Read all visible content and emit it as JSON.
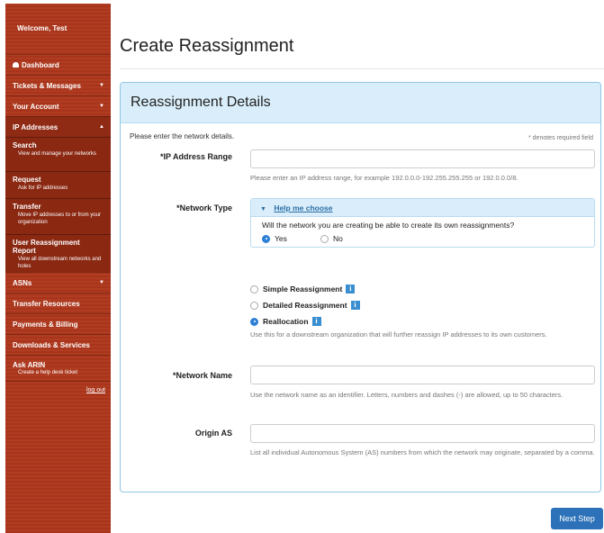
{
  "sidebar": {
    "welcome": "Welcome, Test",
    "dashboard": "Dashboard",
    "tickets": "Tickets & Messages",
    "account": "Your Account",
    "ip_addresses": "IP Addresses",
    "search": {
      "label": "Search",
      "desc": "View and manage your networks"
    },
    "request": {
      "label": "Request",
      "desc": "Ask for IP addresses"
    },
    "transfer": {
      "label": "Transfer",
      "desc": "Move IP addresses to or from your organization"
    },
    "user_report": {
      "label": "User Reassignment Report",
      "desc": "View all downstream networks and holes"
    },
    "asns": "ASNs",
    "transfer_resources": "Transfer Resources",
    "payments": "Payments & Billing",
    "downloads": "Downloads & Services",
    "ask": {
      "label": "Ask ARIN",
      "desc": "Create a help desk ticket"
    },
    "logout": "log out"
  },
  "page": {
    "title": "Create Reassignment"
  },
  "panel": {
    "title": "Reassignment Details",
    "intro": "Please enter the network details.",
    "required_note": "* denotes required field"
  },
  "form": {
    "ip_range": {
      "label": "*IP Address Range",
      "value": "",
      "help": "Please enter an IP address range, for example 192.0.0.0-192.255.255.255 or 192.0.0.0/8."
    },
    "network_type": {
      "label": "*Network Type",
      "help_link": "Help me choose",
      "question": "Will the network you are creating be able to create its own reassignments?",
      "yes": "Yes",
      "no": "No",
      "simple": "Simple Reassignment",
      "detailed": "Detailed Reassignment",
      "reallocation": "Reallocation",
      "reallocation_help": "Use this for a downstream organization that will further reassign IP addresses to its own customers."
    },
    "network_name": {
      "label": "*Network Name",
      "value": "",
      "help": "Use the network name as an identifier. Letters, numbers and dashes (-) are allowed, up to 50 characters."
    },
    "origin_as": {
      "label": "Origin AS",
      "value": "",
      "help": "List all individual Autonomous System (AS) numbers from which the network may originate, separated by a comma."
    }
  },
  "actions": {
    "next": "Next Step"
  },
  "colors": {
    "sidebar": "#a8351b",
    "panel_header": "#d9eefa",
    "accent": "#2d72b8"
  }
}
